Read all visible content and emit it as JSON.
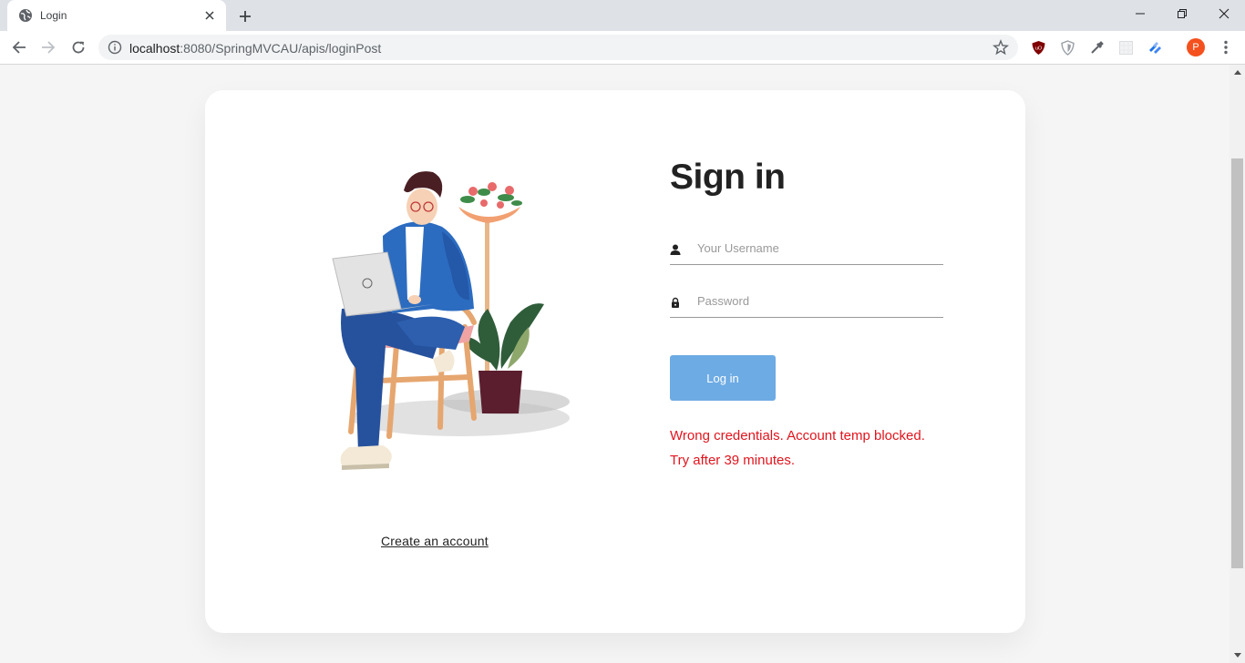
{
  "browser": {
    "tab_title": "Login",
    "url_host": "localhost",
    "url_path": ":8080/SpringMVCAU/apis/loginPost",
    "profile_initial": "P"
  },
  "login": {
    "heading": "Sign in",
    "username_placeholder": "Your Username",
    "password_placeholder": "Password",
    "button_label": "Log in",
    "error_message": "Wrong credentials. Account temp blocked. Try after 39 minutes.",
    "create_account_label": "Create an account"
  },
  "colors": {
    "accent": "#6dabe4",
    "error": "#e1141d",
    "heading": "#222222"
  }
}
